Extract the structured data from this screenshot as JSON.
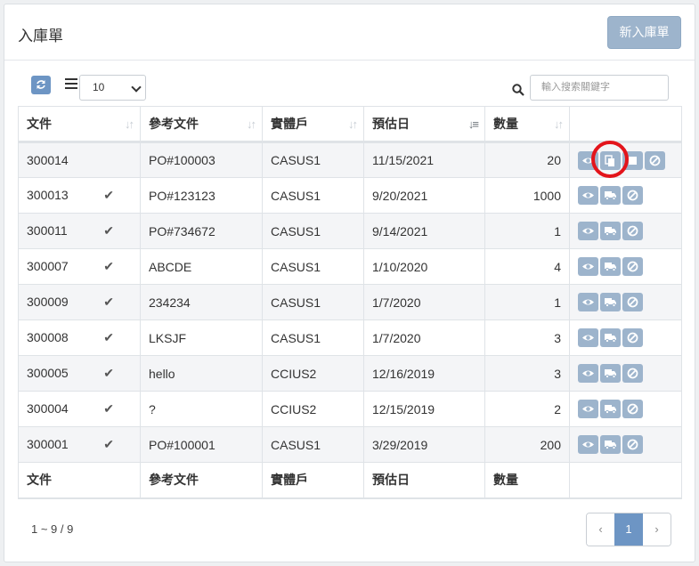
{
  "header": {
    "title": "入庫單",
    "new_button": "新入庫單"
  },
  "toolbar": {
    "page_size": "10",
    "search_placeholder": "輸入搜索關鍵字"
  },
  "table": {
    "columns": [
      "文件",
      "參考文件",
      "實體戶",
      "預估日",
      "數量",
      ""
    ],
    "footer_columns": [
      "文件",
      "參考文件",
      "實體戶",
      "預估日",
      "數量"
    ],
    "rows": [
      {
        "doc": "300014",
        "ref": "PO#100003",
        "entity": "CASUS1",
        "date": "11/15/2021",
        "qty": "20",
        "checked": false
      },
      {
        "doc": "300013",
        "ref": "PO#123123",
        "entity": "CASUS1",
        "date": "9/20/2021",
        "qty": "1000",
        "checked": true
      },
      {
        "doc": "300011",
        "ref": "PO#734672",
        "entity": "CASUS1",
        "date": "9/14/2021",
        "qty": "1",
        "checked": true
      },
      {
        "doc": "300007",
        "ref": "ABCDE",
        "entity": "CASUS1",
        "date": "1/10/2020",
        "qty": "4",
        "checked": true
      },
      {
        "doc": "300009",
        "ref": "234234",
        "entity": "CASUS1",
        "date": "1/7/2020",
        "qty": "1",
        "checked": true
      },
      {
        "doc": "300008",
        "ref": "LKSJF",
        "entity": "CASUS1",
        "date": "1/7/2020",
        "qty": "3",
        "checked": true
      },
      {
        "doc": "300005",
        "ref": "hello",
        "entity": "CCIUS2",
        "date": "12/16/2019",
        "qty": "3",
        "checked": true
      },
      {
        "doc": "300004",
        "ref": "?",
        "entity": "CCIUS2",
        "date": "12/15/2019",
        "qty": "2",
        "checked": true
      },
      {
        "doc": "300001",
        "ref": "PO#100001",
        "entity": "CASUS1",
        "date": "3/29/2019",
        "qty": "200",
        "checked": true
      }
    ]
  },
  "pagination": {
    "info": "1 ~ 9 / 9",
    "prev": "‹",
    "current": "1",
    "next": "›"
  }
}
